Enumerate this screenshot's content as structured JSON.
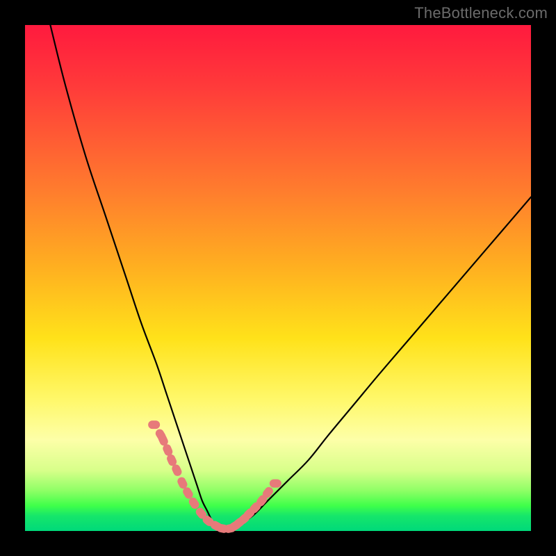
{
  "watermark": "TheBottleneck.com",
  "colors": {
    "frame_bg": "#000000",
    "curve_stroke": "#000000",
    "marker_fill": "#e77a7a",
    "marker_stroke": "#e77a7a"
  },
  "chart_data": {
    "type": "line",
    "title": "",
    "xlabel": "",
    "ylabel": "",
    "xlim": [
      0,
      100
    ],
    "ylim": [
      0,
      100
    ],
    "grid": false,
    "series": [
      {
        "name": "bottleneck-curve",
        "x": [
          5,
          8,
          12,
          16,
          20,
          23,
          26,
          28,
          30,
          32,
          33,
          34,
          35,
          36,
          37,
          38,
          39,
          40,
          42,
          45,
          48,
          52,
          56,
          60,
          65,
          70,
          76,
          82,
          88,
          94,
          100
        ],
        "y": [
          100,
          88,
          74,
          62,
          50,
          41,
          33,
          27,
          21,
          15,
          12,
          9,
          6,
          4,
          2,
          1,
          0,
          0,
          1,
          3,
          6,
          10,
          14,
          19,
          25,
          31,
          38,
          45,
          52,
          59,
          66
        ]
      }
    ],
    "markers": {
      "name": "highlight-dots",
      "x": [
        25.5,
        26.8,
        27.3,
        28.2,
        29.0,
        30.0,
        31.1,
        32.2,
        33.4,
        34.8,
        36.2,
        37.8,
        39.0,
        40.5,
        41.5,
        42.3,
        43.3,
        44.3,
        45.5,
        46.8,
        48.0,
        49.5
      ],
      "y": [
        21.0,
        19.0,
        18.0,
        16.0,
        14.0,
        12.0,
        9.5,
        7.5,
        5.5,
        3.5,
        2.0,
        1.0,
        0.5,
        0.5,
        1.0,
        1.6,
        2.4,
        3.4,
        4.6,
        6.0,
        7.6,
        9.4
      ]
    }
  }
}
